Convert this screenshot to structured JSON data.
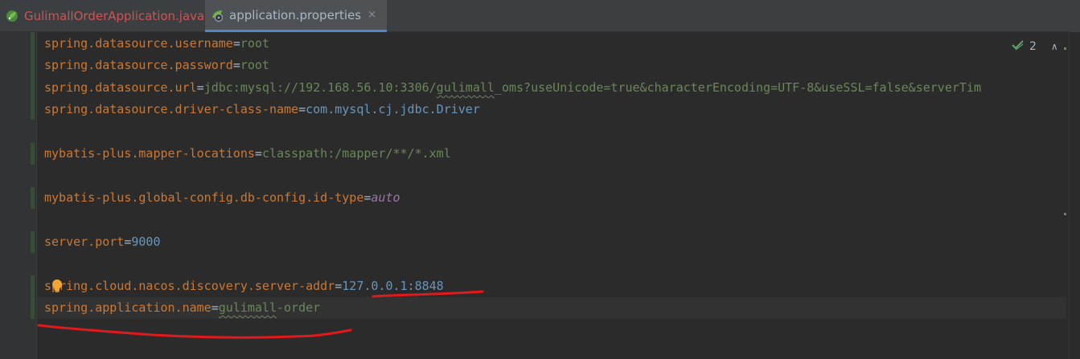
{
  "tabs": [
    {
      "label": "GulimallOrderApplication.java",
      "active": false,
      "icon": "spring-boot-class-icon"
    },
    {
      "label": "application.properties",
      "active": true,
      "icon": "spring-properties-icon"
    }
  ],
  "tab_close_glyph": "×",
  "inspections": {
    "count": "2",
    "up": "∧",
    "down": "∨"
  },
  "lines": [
    {
      "key": "spring.datasource.username",
      "eq": "=",
      "value": "root",
      "value_style": "string"
    },
    {
      "key": "spring.datasource.password",
      "eq": "=",
      "value": "root",
      "value_style": "string"
    },
    {
      "key": "spring.datasource.url",
      "eq": "=",
      "value_parts": [
        "jdbc:mysql://192.168.56.10:3306/",
        "gulimall",
        "_oms?useUnicode=true&characterEncoding=UTF-8&useSSL=false&serverTim"
      ]
    },
    {
      "key": "spring.datasource.driver-class-name",
      "eq": "=",
      "value": "com.mysql.cj.jdbc.Driver",
      "value_style": "plain"
    },
    {
      "key": "mybatis-plus.mapper-locations",
      "eq": "=",
      "value": "classpath:/mapper/**/*.xml",
      "value_style": "string"
    },
    {
      "key": "mybatis-plus.global-config.db-config.id-type",
      "eq": "=",
      "value": "auto",
      "value_style": "italic"
    },
    {
      "key": "server.port",
      "eq": "=",
      "value": "9000",
      "value_style": "number"
    },
    {
      "key": "spring.cloud.nacos.discovery.server-addr",
      "eq": "=",
      "value": "127.0.0.1:8848",
      "value_style": "number"
    },
    {
      "key": "spring.application.name",
      "eq": "=",
      "value_parts": [
        "gulimall",
        "-order"
      ]
    }
  ],
  "colors": {
    "key": "#cc7832",
    "string": "#6a8759",
    "number": "#6897bb",
    "annotation": "#e0191c",
    "active_tab_underline": "#4a88c7"
  }
}
